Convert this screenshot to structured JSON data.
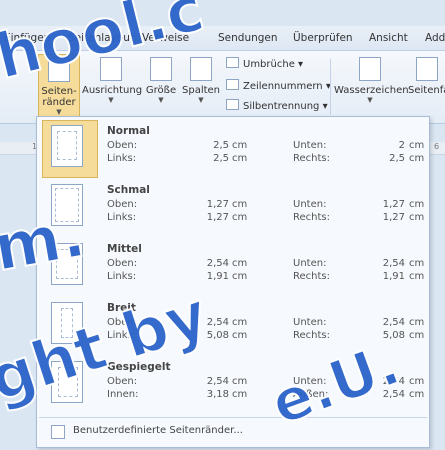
{
  "tabs": [
    "Einfügen",
    "Seitenlayout",
    "Verweise",
    "Sendungen",
    "Überprüfen",
    "Ansicht",
    "Add"
  ],
  "ribbon": {
    "margins_label": "Seiten-\nränder",
    "orientation": "Ausrichtung",
    "size": "Größe",
    "columns": "Spalten",
    "breaks": "Umbrüche",
    "line_numbers": "Zeilennummern",
    "hyphenation": "Silbentrennung",
    "watermark": "Wasserzeichen",
    "page_color": "Seitenfa"
  },
  "ruler": [
    "1",
    "6"
  ],
  "margins_menu": {
    "items": [
      {
        "name": "Normal",
        "top": "2,5",
        "bottom": "2",
        "left": "2,5",
        "right": "2,5",
        "top_label": "Oben:",
        "bottom_label": "Unten:",
        "left_label": "Links:",
        "right_label": "Rechts:"
      },
      {
        "name": "Schmal",
        "top": "1,27",
        "bottom": "1,27",
        "left": "1,27",
        "right": "1,27",
        "top_label": "Oben:",
        "bottom_label": "Unten:",
        "left_label": "Links:",
        "right_label": "Rechts:"
      },
      {
        "name": "Mittel",
        "top": "2,54",
        "bottom": "2,54",
        "left": "1,91",
        "right": "1,91",
        "top_label": "Oben:",
        "bottom_label": "Unten:",
        "left_label": "Links:",
        "right_label": "Rechts:"
      },
      {
        "name": "Breit",
        "top": "2,54",
        "bottom": "2,54",
        "left": "5,08",
        "right": "5,08",
        "top_label": "Oben:",
        "bottom_label": "Unten:",
        "left_label": "Links:",
        "right_label": "Rechts:"
      },
      {
        "name": "Gespiegelt",
        "top": "2,54",
        "bottom": "2,54",
        "left": "3,18",
        "right": "2,54",
        "top_label": "Oben:",
        "bottom_label": "Unten:",
        "left_label": "Innen:",
        "right_label": "Außen:"
      }
    ],
    "unit": "cm",
    "custom": "Benutzerdefinierte Seitenränder..."
  },
  "watermark": [
    "hool.c",
    "m.",
    "ght by",
    "e.U."
  ]
}
